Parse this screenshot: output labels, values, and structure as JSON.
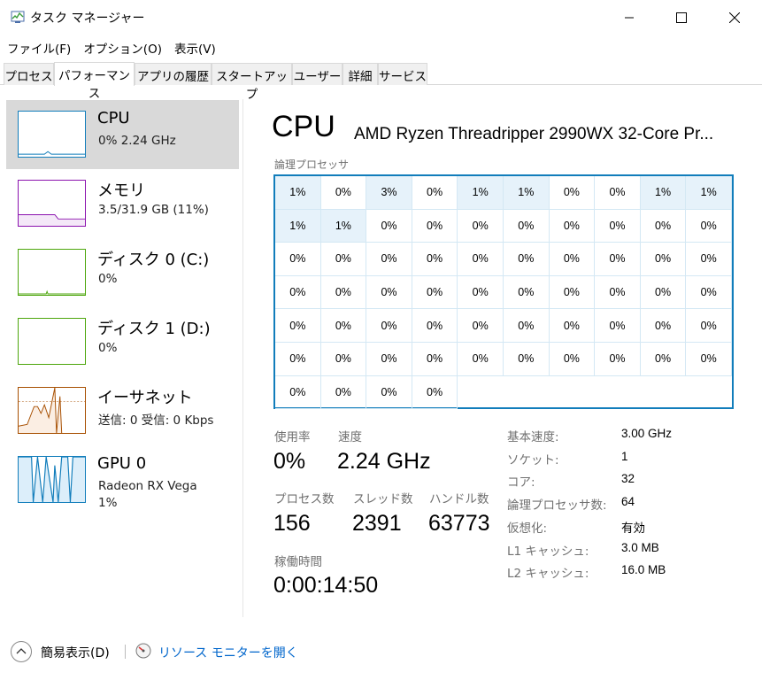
{
  "window": {
    "title": "タスク マネージャー"
  },
  "menu": [
    "ファイル(F)",
    "オプション(O)",
    "表示(V)"
  ],
  "tabs": [
    "プロセス",
    "パフォーマンス",
    "アプリの履歴",
    "スタートアップ",
    "ユーザー",
    "詳細",
    "サービス"
  ],
  "resources": [
    {
      "name": "CPU",
      "sub": "0%  2.24 GHz",
      "sub2": "",
      "color": "#117dbb"
    },
    {
      "name": "メモリ",
      "sub": "3.5/31.9 GB (11%)",
      "sub2": "",
      "color": "#8b12ae"
    },
    {
      "name": "ディスク 0 (C:)",
      "sub": "0%",
      "sub2": "",
      "color": "#4da60c"
    },
    {
      "name": "ディスク 1 (D:)",
      "sub": "0%",
      "sub2": "",
      "color": "#4da60c"
    },
    {
      "name": "イーサネット",
      "sub": "送信: 0 受信: 0 Kbps",
      "sub2": "",
      "color": "#a74f01"
    },
    {
      "name": "GPU 0",
      "sub": "Radeon RX Vega",
      "sub2": "1%",
      "color": "#117dbb"
    }
  ],
  "cpu": {
    "title": "CPU",
    "model": "AMD Ryzen Threadripper 2990WX 32-Core Pr...",
    "grid_label": "論理プロセッサ",
    "logical_processors": [
      "1%",
      "0%",
      "3%",
      "0%",
      "1%",
      "1%",
      "0%",
      "0%",
      "1%",
      "1%",
      "1%",
      "1%",
      "0%",
      "0%",
      "0%",
      "0%",
      "0%",
      "0%",
      "0%",
      "0%",
      "0%",
      "0%",
      "0%",
      "0%",
      "0%",
      "0%",
      "0%",
      "0%",
      "0%",
      "0%",
      "0%",
      "0%",
      "0%",
      "0%",
      "0%",
      "0%",
      "0%",
      "0%",
      "0%",
      "0%",
      "0%",
      "0%",
      "0%",
      "0%",
      "0%",
      "0%",
      "0%",
      "0%",
      "0%",
      "0%",
      "0%",
      "0%",
      "0%",
      "0%",
      "0%",
      "0%",
      "0%",
      "0%",
      "0%",
      "0%",
      "0%",
      "0%",
      "0%",
      "0%"
    ],
    "stats": {
      "usage_label": "使用率",
      "usage": "0%",
      "speed_label": "速度",
      "speed": "2.24 GHz",
      "processes_label": "プロセス数",
      "processes": "156",
      "threads_label": "スレッド数",
      "threads": "2391",
      "handles_label": "ハンドル数",
      "handles": "63773",
      "uptime_label": "稼働時間",
      "uptime": "0:00:14:50"
    },
    "specs": [
      {
        "k": "基本速度:",
        "v": "3.00 GHz"
      },
      {
        "k": "ソケット:",
        "v": "1"
      },
      {
        "k": "コア:",
        "v": "32"
      },
      {
        "k": "論理プロセッサ数:",
        "v": "64"
      },
      {
        "k": "仮想化:",
        "v": "有効"
      },
      {
        "k": "L1 キャッシュ:",
        "v": "3.0 MB"
      },
      {
        "k": "L2 キャッシュ:",
        "v": "16.0 MB"
      }
    ]
  },
  "footer": {
    "fewer_details": "簡易表示(D)",
    "resource_monitor": "リソース モニターを開く"
  }
}
